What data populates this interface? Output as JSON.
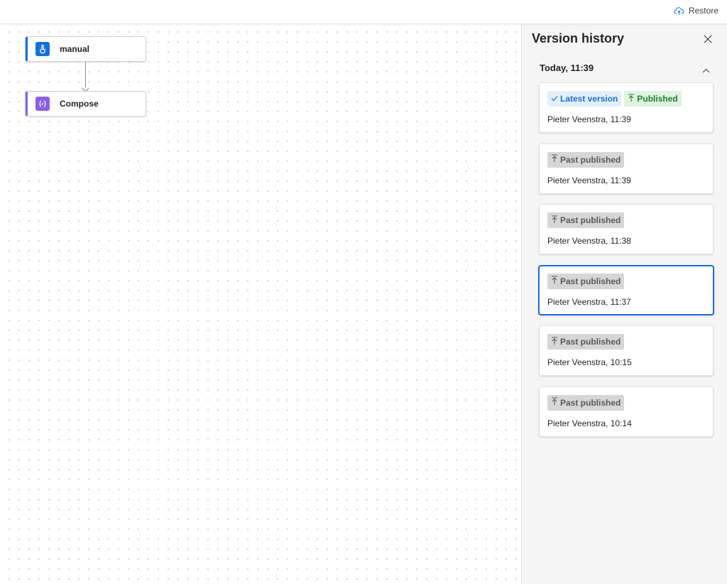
{
  "toolbar": {
    "restore_label": "Restore",
    "restore_icon": "cloud-upload-icon"
  },
  "flow": {
    "nodes": [
      {
        "label": "manual",
        "icon": "manual-trigger-icon",
        "accent": "#1170e0"
      },
      {
        "label": "Compose",
        "icon": "compose-icon",
        "accent": "#8c5ee3"
      }
    ]
  },
  "panel": {
    "title": "Version history",
    "group": {
      "header": "Today, 11:39",
      "expanded": true
    },
    "versions": [
      {
        "badges": [
          {
            "type": "latest",
            "label": "Latest version"
          },
          {
            "type": "published",
            "label": "Published"
          }
        ],
        "meta": "Pieter Veenstra, 11:39",
        "selected": false
      },
      {
        "badges": [
          {
            "type": "past",
            "label": "Past published"
          }
        ],
        "meta": "Pieter Veenstra, 11:39",
        "selected": false
      },
      {
        "badges": [
          {
            "type": "past",
            "label": "Past published"
          }
        ],
        "meta": "Pieter Veenstra, 11:38",
        "selected": false
      },
      {
        "badges": [
          {
            "type": "past",
            "label": "Past published"
          }
        ],
        "meta": "Pieter Veenstra, 11:37",
        "selected": true
      },
      {
        "badges": [
          {
            "type": "past",
            "label": "Past published"
          }
        ],
        "meta": "Pieter Veenstra, 10:15",
        "selected": false
      },
      {
        "badges": [
          {
            "type": "past",
            "label": "Past published"
          }
        ],
        "meta": "Pieter Veenstra, 10:14",
        "selected": false
      }
    ]
  },
  "colors": {
    "accent": "#1a6fd6",
    "published_green": "#1f7d2f",
    "past_badge_bg": "#d6d6d6"
  }
}
